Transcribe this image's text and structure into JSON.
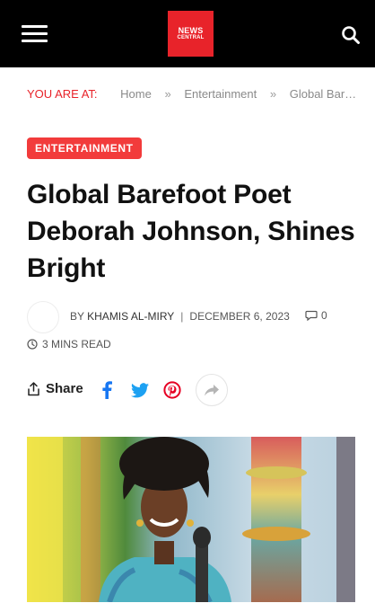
{
  "header": {
    "logo_line1": "NEWS",
    "logo_line2": "CENTRAL",
    "icons": {
      "menu": "hamburger-icon",
      "search": "search-icon"
    }
  },
  "breadcrumb": {
    "prefix": "YOU ARE AT:",
    "items": [
      "Home",
      "Entertainment",
      "Global Bar…"
    ],
    "separator": "»"
  },
  "article": {
    "category": "ENTERTAINMENT",
    "title": "Global Barefoot Poet Deborah Johnson, Shines Bright",
    "by_label": "BY",
    "author": "KHAMIS AL-MIRY",
    "date": "DECEMBER 6, 2023",
    "comments": "0",
    "read_time": "3 MINS READ"
  },
  "share": {
    "label": "Share",
    "icons": [
      "facebook-icon",
      "twitter-icon",
      "pinterest-icon",
      "more-share-icon"
    ]
  },
  "colors": {
    "accent": "#e8232a",
    "badge": "#f23b3b",
    "facebook": "#1877f2",
    "twitter": "#1da1f2",
    "pinterest": "#e60023"
  }
}
